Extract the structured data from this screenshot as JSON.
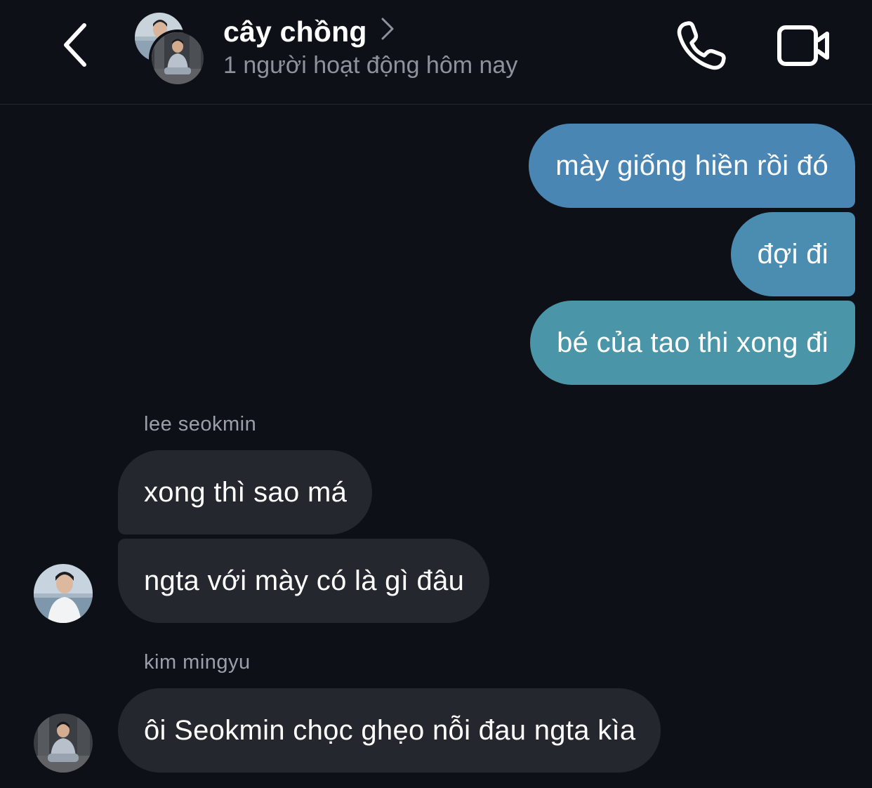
{
  "header": {
    "title": "cây chồng",
    "status": "1 người hoạt động hôm nay",
    "icons": [
      "back-chevron-icon",
      "chevron-right-icon",
      "phone-icon",
      "video-camera-icon"
    ]
  },
  "messages": [
    {
      "direction": "outgoing",
      "text": "mày giống hiền rồi đó",
      "color": "#4a86b4"
    },
    {
      "direction": "outgoing",
      "text": "đợi đi",
      "color": "#4b8db0"
    },
    {
      "direction": "outgoing",
      "text": "bé của tao thi xong đi",
      "color": "#4a96a8"
    },
    {
      "direction": "incoming",
      "sender": "lee seokmin",
      "text": "xong thì sao má"
    },
    {
      "direction": "incoming",
      "text": "ngta với mày có là gì đâu"
    },
    {
      "direction": "incoming",
      "sender": "kim mingyu",
      "text": "ôi Seokmin chọc ghẹo nỗi đau ngta kìa"
    }
  ],
  "colors": {
    "background": "#0d1016",
    "incoming_bubble": "#24272d",
    "sender_text": "#9ba0a8",
    "status_text": "#8e939b"
  }
}
